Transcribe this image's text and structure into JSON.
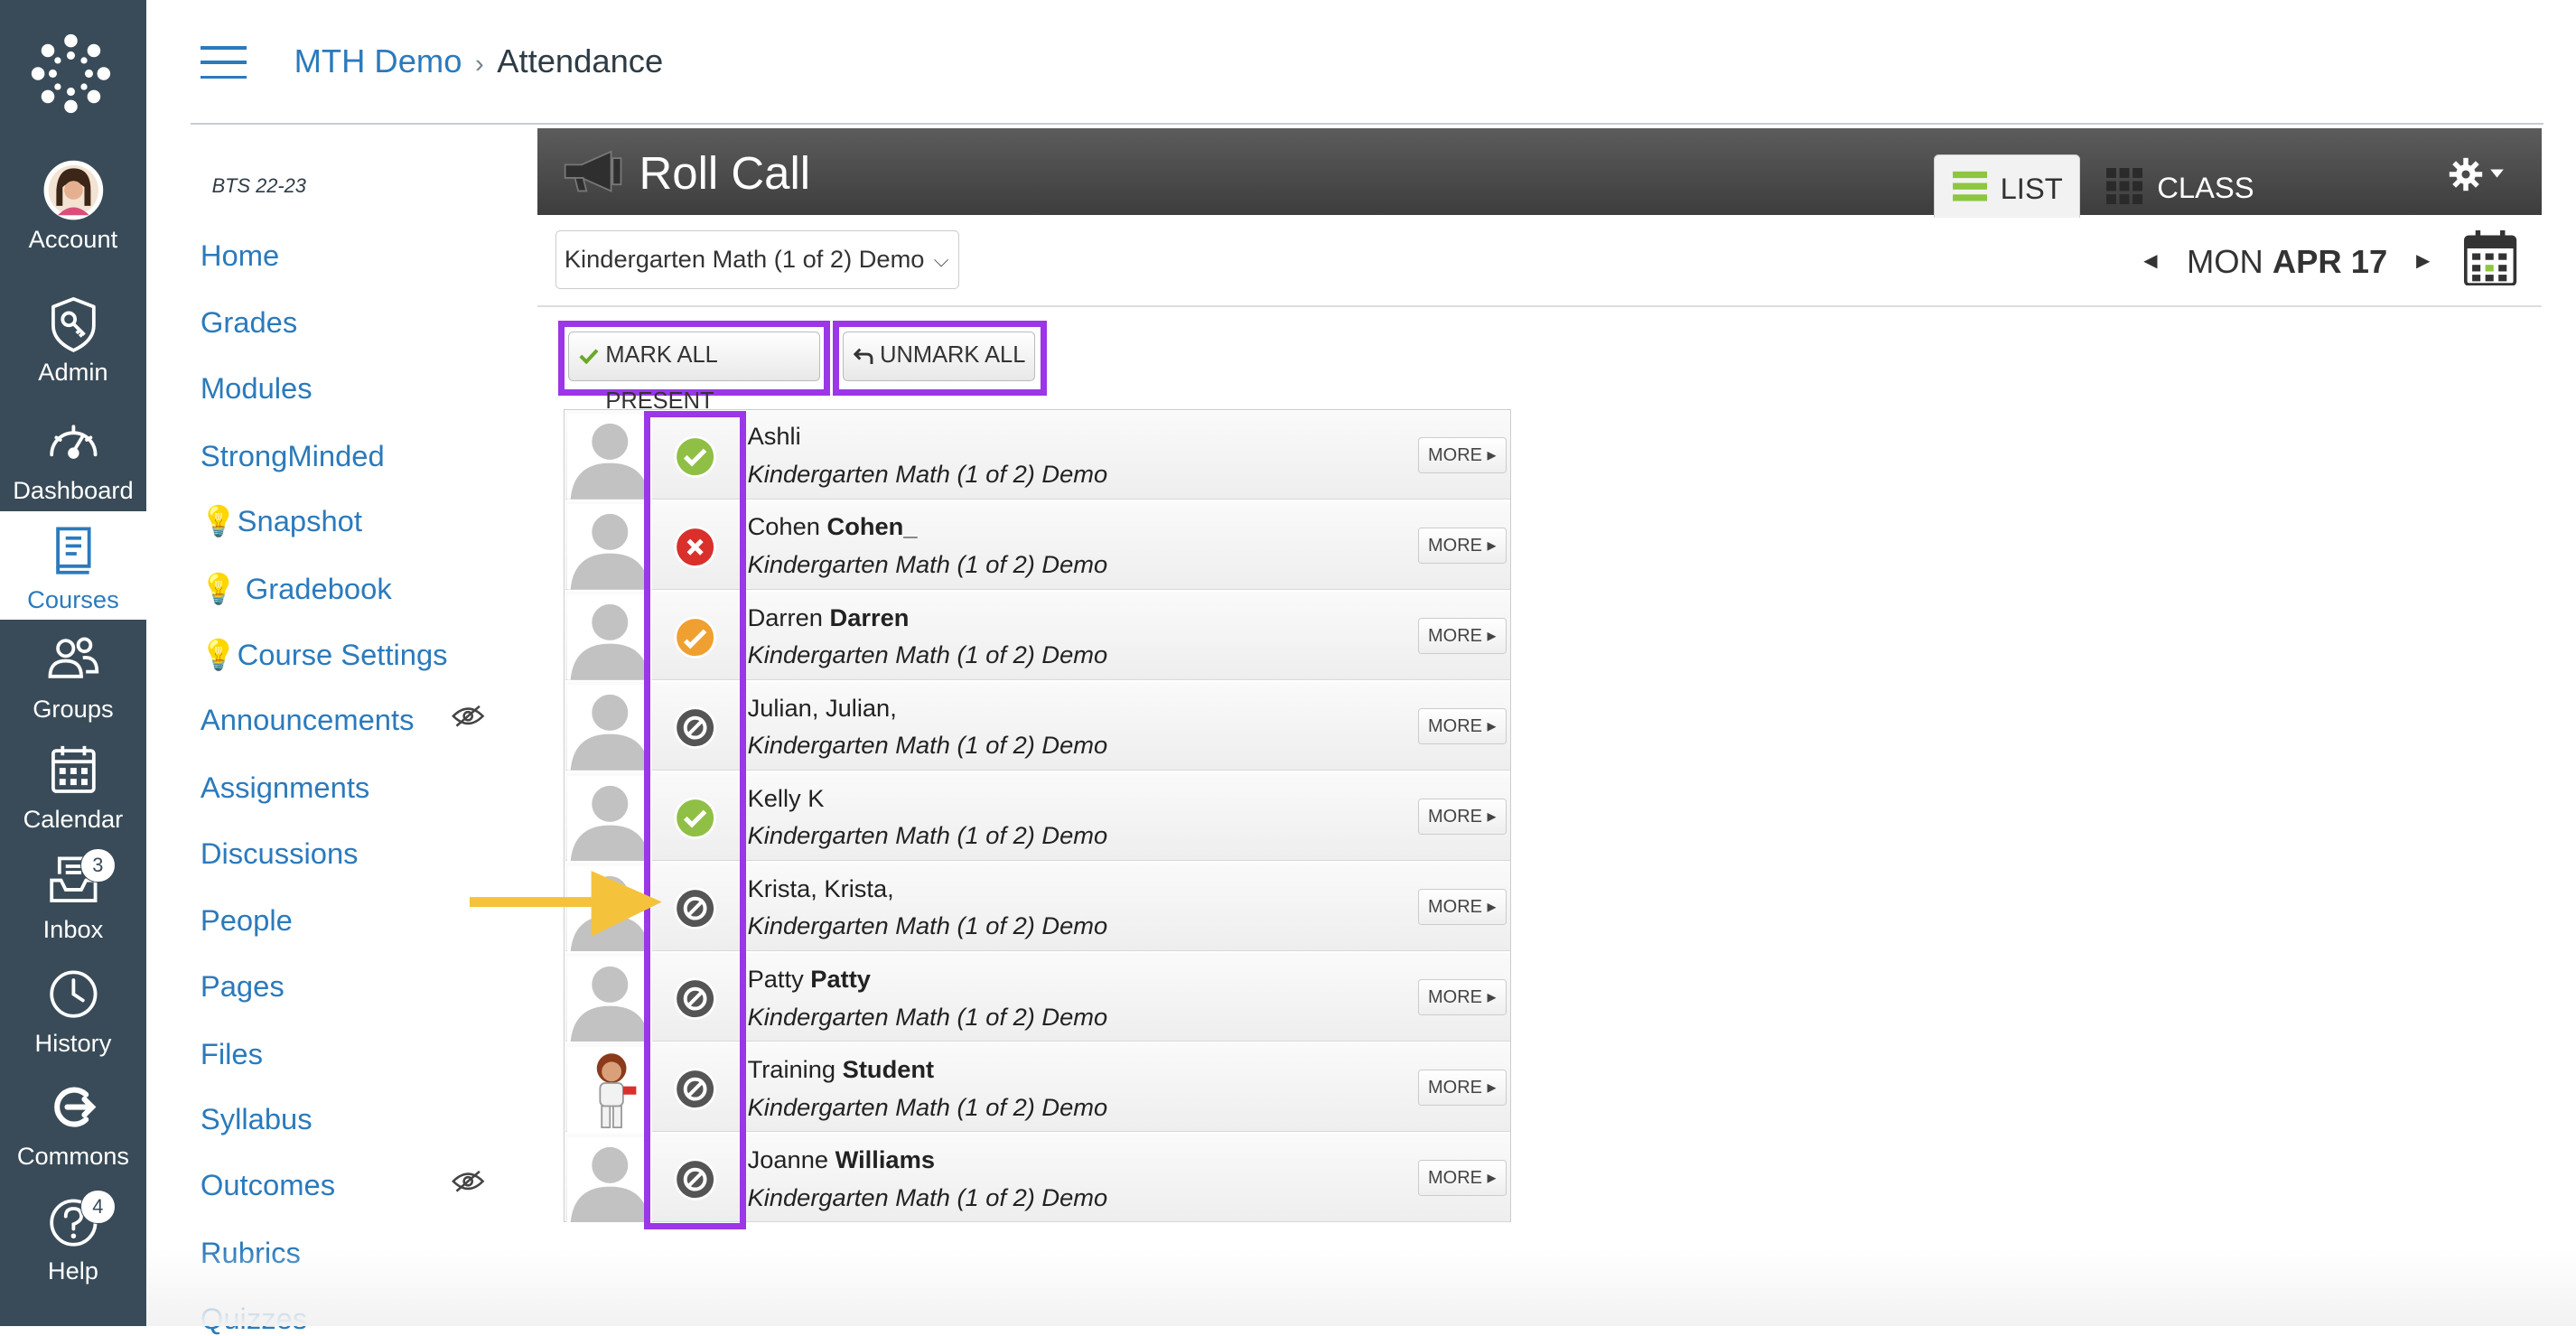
{
  "global_nav": [
    {
      "label": "Account",
      "icon": "account-avatar-icon"
    },
    {
      "label": "Admin",
      "icon": "admin-icon"
    },
    {
      "label": "Dashboard",
      "icon": "dashboard-icon"
    },
    {
      "label": "Courses",
      "icon": "courses-icon",
      "active": true
    },
    {
      "label": "Groups",
      "icon": "groups-icon"
    },
    {
      "label": "Calendar",
      "icon": "calendar-icon"
    },
    {
      "label": "Inbox",
      "icon": "inbox-icon",
      "badge": "3"
    },
    {
      "label": "History",
      "icon": "history-icon"
    },
    {
      "label": "Commons",
      "icon": "commons-icon"
    },
    {
      "label": "Help",
      "icon": "help-icon",
      "badge": "4"
    }
  ],
  "breadcrumb": {
    "course": "MTH Demo",
    "separator": "›",
    "page": "Attendance"
  },
  "course_nav": {
    "term": "BTS 22-23",
    "items": [
      "Home",
      "Grades",
      "Modules",
      "StrongMinded",
      "💡Snapshot",
      "💡 Gradebook",
      "💡Course Settings",
      "Announcements",
      "Assignments",
      "Discussions",
      "People",
      "Pages",
      "Files",
      "Syllabus",
      "Outcomes",
      "Rubrics",
      "Quizzes"
    ]
  },
  "roll_call": {
    "title": "Roll Call",
    "tabs": {
      "list": "LIST",
      "class": "CLASS"
    },
    "course_select": "Kindergarten Math (1 of 2) Demo",
    "date": {
      "day": "MON",
      "rest": "APR 17",
      "prev": "◄",
      "next": "►"
    },
    "mark_all_present": "MARK ALL PRESENT",
    "unmark_all": "UNMARK ALL",
    "more_label": "MORE ▸",
    "students": [
      {
        "first": "Ashli",
        "last": "",
        "course": "Kindergarten Math (1 of 2) Demo",
        "status": "present"
      },
      {
        "first": "Cohen",
        "last": "Cohen_",
        "course": "Kindergarten Math (1 of 2) Demo",
        "status": "absent"
      },
      {
        "first": "Darren",
        "last": "Darren",
        "course": "Kindergarten Math (1 of 2) Demo",
        "status": "late"
      },
      {
        "first": "Julian, Julian,",
        "last": "",
        "course": "Kindergarten Math (1 of 2) Demo",
        "status": "unmarked"
      },
      {
        "first": "Kelly K",
        "last": "",
        "course": "Kindergarten Math (1 of 2) Demo",
        "status": "present"
      },
      {
        "first": "Krista, Krista,",
        "last": "",
        "course": "Kindergarten Math (1 of 2) Demo",
        "status": "unmarked"
      },
      {
        "first": "Patty",
        "last": "Patty",
        "course": "Kindergarten Math (1 of 2) Demo",
        "status": "unmarked"
      },
      {
        "first": "Training",
        "last": "Student",
        "course": "Kindergarten Math (1 of 2) Demo",
        "status": "unmarked"
      },
      {
        "first": "Joanne",
        "last": "Williams",
        "course": "Kindergarten Math (1 of 2) Demo",
        "status": "unmarked"
      }
    ]
  },
  "colors": {
    "nav_bg": "#394b58",
    "link": "#2b7abc",
    "highlight": "#9b37e6",
    "arrow": "#f5c33b",
    "present": "#8fbf45",
    "absent": "#d9302c",
    "late": "#f0a030",
    "unmarked": "#555555"
  }
}
